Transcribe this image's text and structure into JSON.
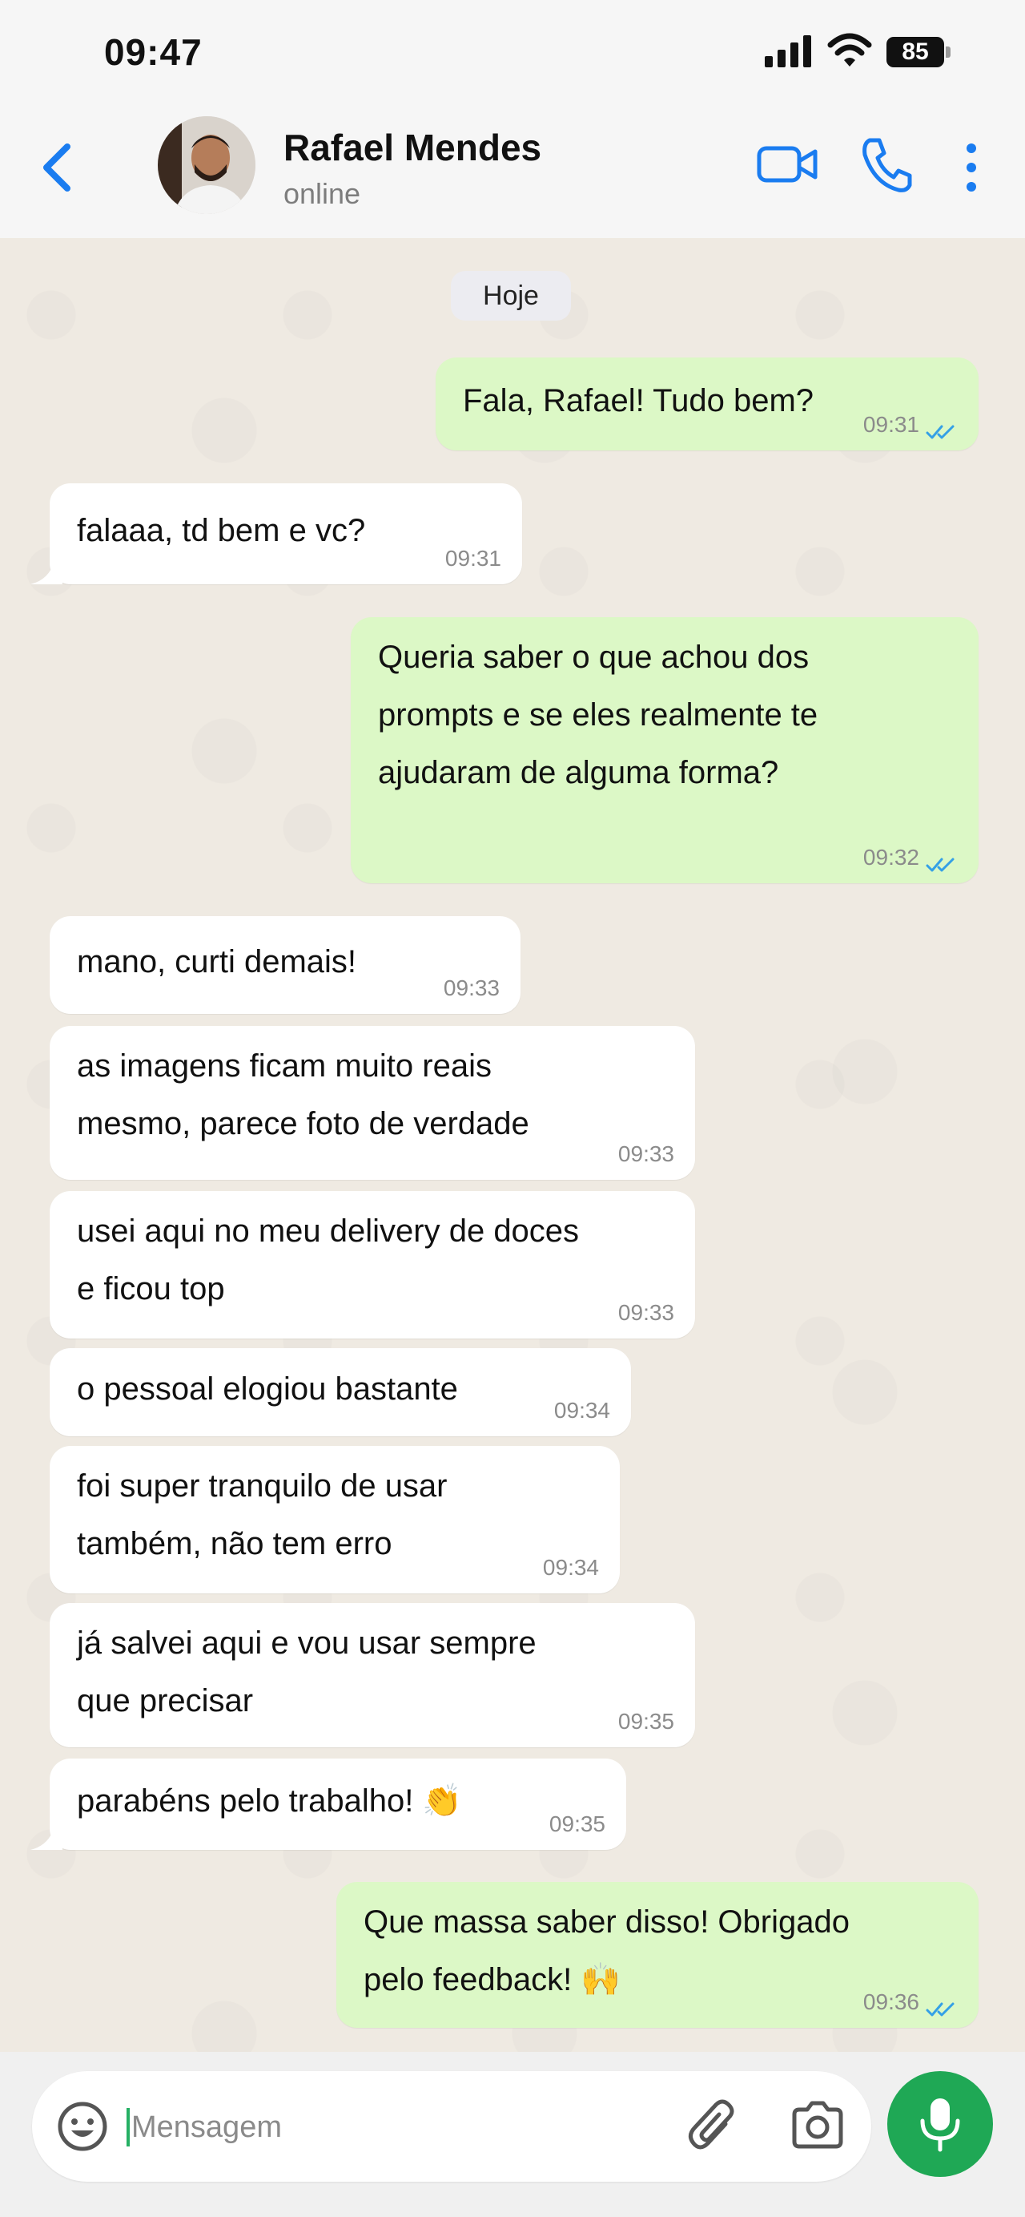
{
  "status_bar": {
    "time": "09:47",
    "battery": "85"
  },
  "header": {
    "contact_name": "Rafael Mendes",
    "contact_status": "online"
  },
  "chat": {
    "date_label": "Hoje",
    "messages": [
      {
        "dir": "out",
        "lines": [
          "Fala, Rafael! Tudo bem?"
        ],
        "time": "09:31",
        "read": true
      },
      {
        "dir": "in",
        "lines": [
          "falaaa, td bem e vc?"
        ],
        "time": "09:31"
      },
      {
        "dir": "out",
        "lines": [
          "Queria saber o que achou dos",
          "prompts e se eles realmente te",
          "ajudaram de alguma forma?"
        ],
        "time": "09:32",
        "read": true
      },
      {
        "dir": "in",
        "lines": [
          "mano, curti demais!"
        ],
        "time": "09:33"
      },
      {
        "dir": "in",
        "lines": [
          "as imagens ficam muito reais",
          "mesmo, parece foto de verdade"
        ],
        "time": "09:33"
      },
      {
        "dir": "in",
        "lines": [
          "usei aqui no meu delivery de doces",
          "e ficou top"
        ],
        "time": "09:33"
      },
      {
        "dir": "in",
        "lines": [
          "o pessoal elogiou bastante"
        ],
        "time": "09:34"
      },
      {
        "dir": "in",
        "lines": [
          "foi super tranquilo de usar",
          "também, não tem erro"
        ],
        "time": "09:34"
      },
      {
        "dir": "in",
        "lines": [
          "já salvei aqui e vou usar sempre",
          "que precisar"
        ],
        "time": "09:35"
      },
      {
        "dir": "in",
        "lines": [
          "parabéns pelo trabalho! 👏"
        ],
        "time": "09:35"
      },
      {
        "dir": "out",
        "lines": [
          "Que massa saber disso! Obrigado",
          "pelo feedback! 🙌"
        ],
        "time": "09:36",
        "read": true
      }
    ]
  },
  "input": {
    "placeholder": "Mensagem"
  },
  "colors": {
    "accent_blue": "#1a7cf0",
    "out_bubble": "#dcf8c6",
    "in_bubble": "#ffffff",
    "mic_green": "#1fa855",
    "read_ticks": "#34a0e6"
  },
  "icons": [
    "back-chevron-icon",
    "video-call-icon",
    "phone-icon",
    "more-vertical-icon",
    "emoji-icon",
    "paperclip-icon",
    "camera-icon",
    "mic-icon",
    "signal-icon",
    "wifi-icon",
    "battery-icon",
    "double-check-icon"
  ]
}
